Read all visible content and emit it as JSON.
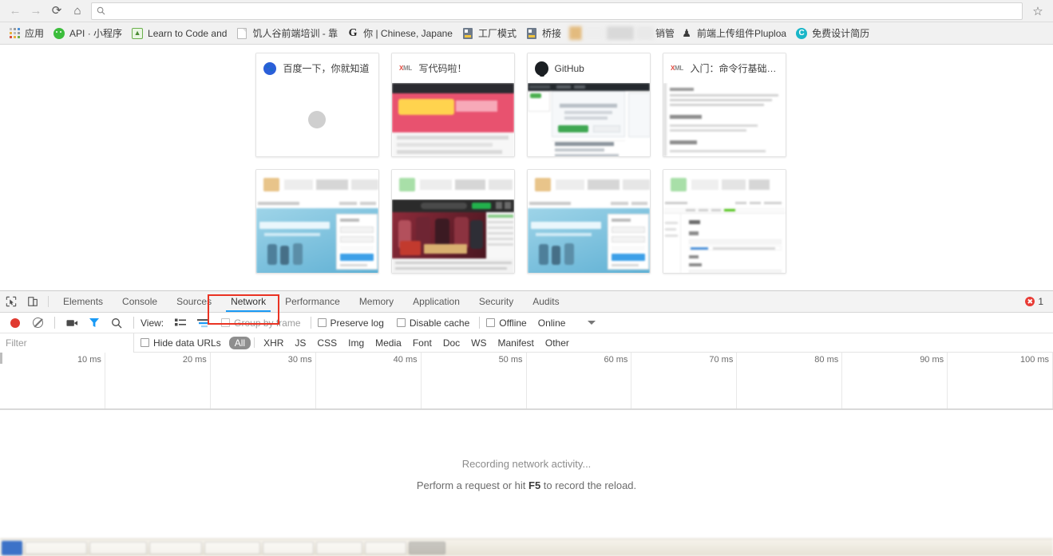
{
  "browser": {
    "nav": {
      "back_icon": "arrow-left-icon",
      "forward_icon": "arrow-right-icon",
      "reload_icon": "reload-icon",
      "home_icon": "home-icon",
      "star_icon": "star-icon"
    },
    "omnibox": {
      "value": "",
      "placeholder": "",
      "search_icon": "search-icon"
    },
    "bookmarks": [
      {
        "label": "应用",
        "icon": "apps-grid-icon"
      },
      {
        "label": "API · 小程序",
        "icon": "wechat-icon"
      },
      {
        "label": "Learn to Code and",
        "icon": "green-book-icon"
      },
      {
        "label": "饥人谷前端培训 - 靠",
        "icon": "page-icon"
      },
      {
        "label": "你 | Chinese, Japane",
        "icon": "g-letter-icon"
      },
      {
        "label": "工厂模式",
        "icon": "chip-icon"
      },
      {
        "label": "桥接",
        "icon": "chip-icon"
      },
      {
        "label": "销管",
        "icon": "redacted-icon",
        "redacted": true
      },
      {
        "label": "前端上传组件Pluploa",
        "icon": "person-icon"
      },
      {
        "label": "免费设计简历",
        "icon": "c-circle-icon"
      }
    ]
  },
  "page": {
    "tiles": [
      {
        "title": "百度一下，你就知道",
        "favicon": "baidu-icon",
        "preview": "spinner"
      },
      {
        "title": "写代码啦！",
        "favicon": "xml-icon",
        "preview": "mosaic-pink"
      },
      {
        "title": "GitHub",
        "favicon": "github-icon",
        "preview": "github-page"
      },
      {
        "title": "入门：命令行基础 - ...",
        "favicon": "xml-icon",
        "preview": "mosaic-doc"
      },
      {
        "title": "",
        "favicon": "",
        "preview": "mosaic-blue-portal"
      },
      {
        "title": "",
        "favicon": "",
        "preview": "mosaic-dark-media"
      },
      {
        "title": "",
        "favicon": "",
        "preview": "mosaic-blue-portal"
      },
      {
        "title": "",
        "favicon": "",
        "preview": "mosaic-api-doc"
      }
    ]
  },
  "devtools": {
    "left_icons": [
      {
        "name": "inspect-element-icon"
      },
      {
        "name": "device-toolbar-icon"
      }
    ],
    "tabs": [
      {
        "label": "Elements",
        "selected": false
      },
      {
        "label": "Console",
        "selected": false
      },
      {
        "label": "Sources",
        "selected": false
      },
      {
        "label": "Network",
        "selected": true
      },
      {
        "label": "Performance",
        "selected": false
      },
      {
        "label": "Memory",
        "selected": false
      },
      {
        "label": "Application",
        "selected": false
      },
      {
        "label": "Security",
        "selected": false
      },
      {
        "label": "Audits",
        "selected": false
      }
    ],
    "error_count": "1",
    "annotation": {
      "shape": "rectangle",
      "color": "#ea3323",
      "target": "Network"
    },
    "network_toolbar": {
      "record_icon": "record-button",
      "clear_icon": "clear-icon",
      "capture_screenshots_icon": "camera-icon",
      "filter_icon": "funnel-icon",
      "search_icon": "search-icon",
      "view_label": "View:",
      "view_list_icon": "list-view-icon",
      "view_waterfall_icon": "waterfall-view-icon",
      "group_by_frame": {
        "label": "Group by frame",
        "checked": false,
        "disabled": true
      },
      "preserve_log": {
        "label": "Preserve log",
        "checked": false
      },
      "disable_cache": {
        "label": "Disable cache",
        "checked": false
      },
      "offline": {
        "label": "Offline",
        "checked": false
      },
      "throttling": {
        "label": "Online"
      },
      "more_icon": "chevron-down-icon"
    },
    "filter_bar": {
      "filter_placeholder": "Filter",
      "filter_value": "",
      "hide_data_urls": {
        "label": "Hide data URLs",
        "checked": false
      },
      "types": [
        "All",
        "XHR",
        "JS",
        "CSS",
        "Img",
        "Media",
        "Font",
        "Doc",
        "WS",
        "Manifest",
        "Other"
      ],
      "active_type": "All"
    },
    "timeline": {
      "ticks": [
        "10 ms",
        "20 ms",
        "30 ms",
        "40 ms",
        "50 ms",
        "60 ms",
        "70 ms",
        "80 ms",
        "90 ms",
        "100 ms"
      ]
    },
    "empty_state": {
      "line1": "Recording network activity...",
      "line2_before": "Perform a request or hit ",
      "line2_key": "F5",
      "line2_after": " to record the reload."
    }
  },
  "colors": {
    "accent_blue": "#1a9af5",
    "annotation_red": "#ea3323",
    "error_red": "#e83b35",
    "record_red": "#e03a30",
    "chrome_bg": "#f1f1f1"
  }
}
